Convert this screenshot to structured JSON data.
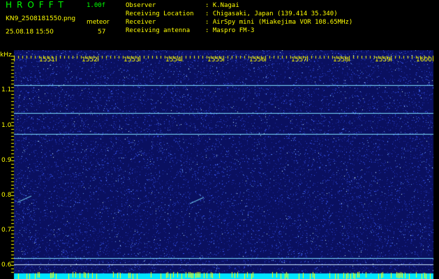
{
  "header": {
    "app_title": "HROFFT",
    "version": "1.00f",
    "filename": "KN9_2508181550.png",
    "mode": "meteor",
    "datetime": "25.08.18 15:50",
    "count": "57"
  },
  "info": [
    {
      "key": "Observer",
      "value": ": K.Nagai"
    },
    {
      "key": "Receiving Location",
      "value": ": Chigasaki, Japan (139.414 35.340)"
    },
    {
      "key": "Receiver",
      "value": ": AirSpy mini (Miakejima VOR 108.65MHz)"
    },
    {
      "key": "Receiving antenna",
      "value": ": Maspro FM-3"
    }
  ],
  "spectrogram": {
    "y_unit": "kHz",
    "y_ticks": [
      "1.1",
      "1.0",
      "0.9",
      "0.8",
      "0.7",
      "0.6"
    ],
    "x_ticks": [
      "1551",
      "1552",
      "1553",
      "1554",
      "1555",
      "1556",
      "1557",
      "1558",
      "1559",
      "1600"
    ],
    "colors": {
      "background": "#0a1060",
      "noise": "#3b5bff",
      "line": "#7fe0ff",
      "tick": "#ffff00",
      "bar": "#00e5ff"
    }
  }
}
